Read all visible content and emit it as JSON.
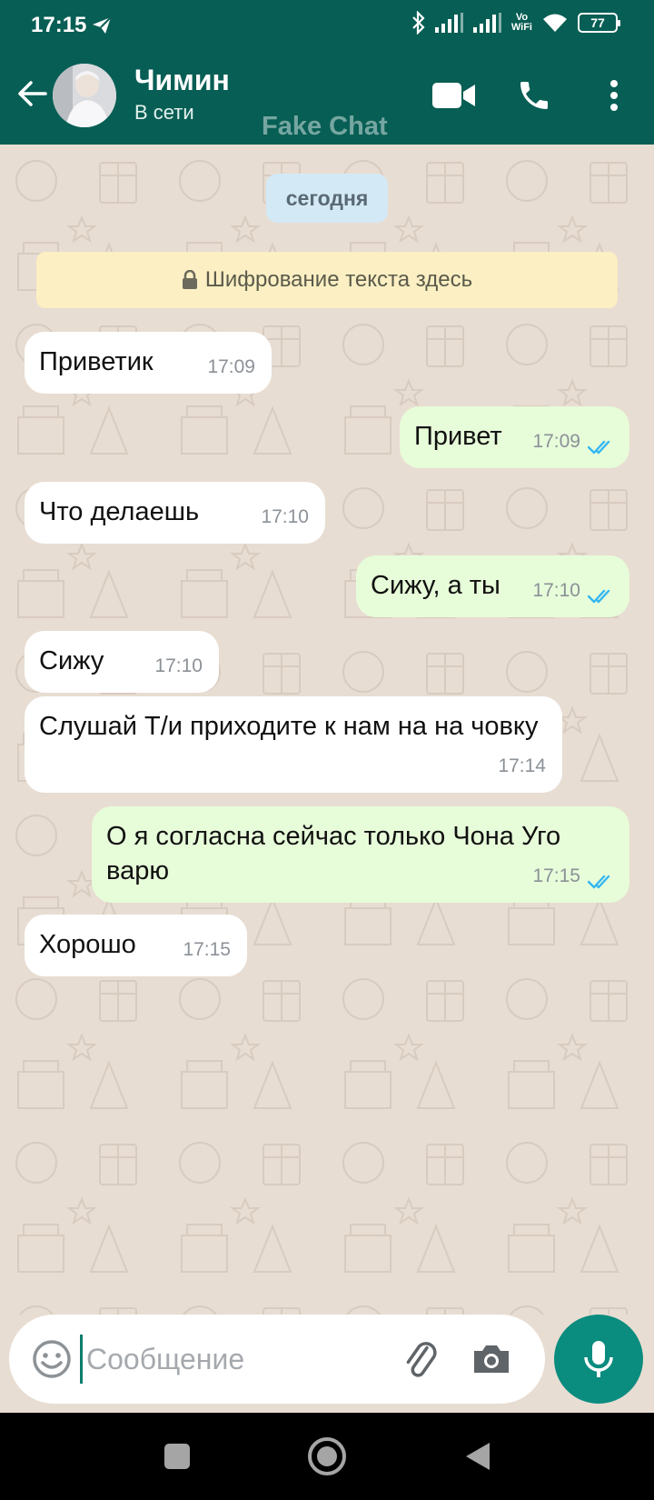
{
  "status_bar": {
    "time": "17:15",
    "volte_top": "Vo",
    "volte_bottom": "WiFi",
    "battery": "77"
  },
  "header": {
    "contact_name": "Чимин",
    "contact_status": "В сети",
    "watermark": "Fake Chat"
  },
  "chat": {
    "date_chip": "сегодня",
    "encryption_note": "Шифрование текста здесь",
    "messages": [
      {
        "direction": "in",
        "text": "Приветик",
        "time": "17:09"
      },
      {
        "direction": "out",
        "text": "Привет",
        "time": "17:09",
        "read": true
      },
      {
        "direction": "in",
        "text": "Что делаешь",
        "time": "17:10"
      },
      {
        "direction": "out",
        "text": "Сижу, а ты",
        "time": "17:10",
        "read": true
      },
      {
        "direction": "in",
        "text": "Сижу",
        "time": "17:10"
      },
      {
        "direction": "in",
        "text": "Слушай Т/и приходите к нам на на човку",
        "time": "17:14"
      },
      {
        "direction": "out",
        "text": "О я согласна сейчас только Чона Уго варю",
        "time": "17:15",
        "read": true
      },
      {
        "direction": "in",
        "text": "Хорошо",
        "time": "17:15"
      }
    ]
  },
  "composer": {
    "placeholder": "Сообщение"
  },
  "colors": {
    "header": "#075e54",
    "outgoing": "#e7fcd9",
    "incoming": "#ffffff",
    "accent": "#0a8c7f",
    "ticks": "#34b7f1"
  },
  "icons": [
    "send-icon",
    "bluetooth-icon",
    "signal-icon",
    "wifi-icon",
    "battery-icon",
    "back-arrow-icon",
    "video-call-icon",
    "phone-icon",
    "more-options-icon",
    "lock-icon",
    "read-ticks-icon",
    "emoji-icon",
    "attach-icon",
    "camera-icon",
    "mic-icon",
    "recent-apps-icon",
    "home-icon",
    "nav-back-icon"
  ]
}
